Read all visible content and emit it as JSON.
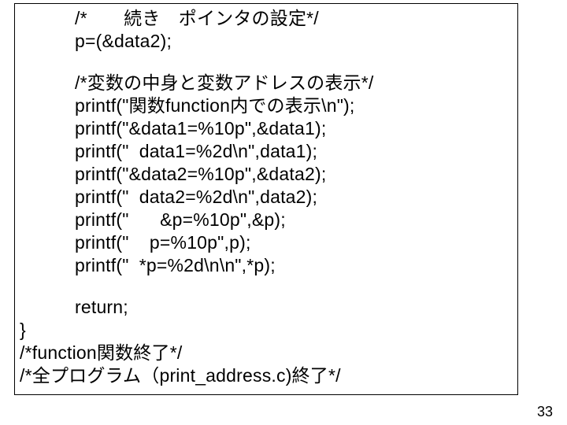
{
  "code": {
    "l01": "/*　　続き　ポインタの設定*/",
    "l02": "p=(&data2);",
    "l03": "/*変数の中身と変数アドレスの表示*/",
    "l04": "printf(\"関数function内での表示\\n\");",
    "l05": "printf(\"&data1=%10p\",&data1);",
    "l06": "printf(\"  data1=%2d\\n\",data1);",
    "l07": "printf(\"&data2=%10p\",&data2);",
    "l08": "printf(\"  data2=%2d\\n\",data2);",
    "l09": "printf(\"      &p=%10p\",&p);",
    "l10": "printf(\"    p=%10p\",p);",
    "l11": "printf(\"  *p=%2d\\n\\n\",*p);",
    "l12": "return;",
    "l13": "}",
    "l14": "/*function関数終了*/",
    "l15": "/*全プログラム（print_address.c)終了*/"
  },
  "page_number": "33"
}
